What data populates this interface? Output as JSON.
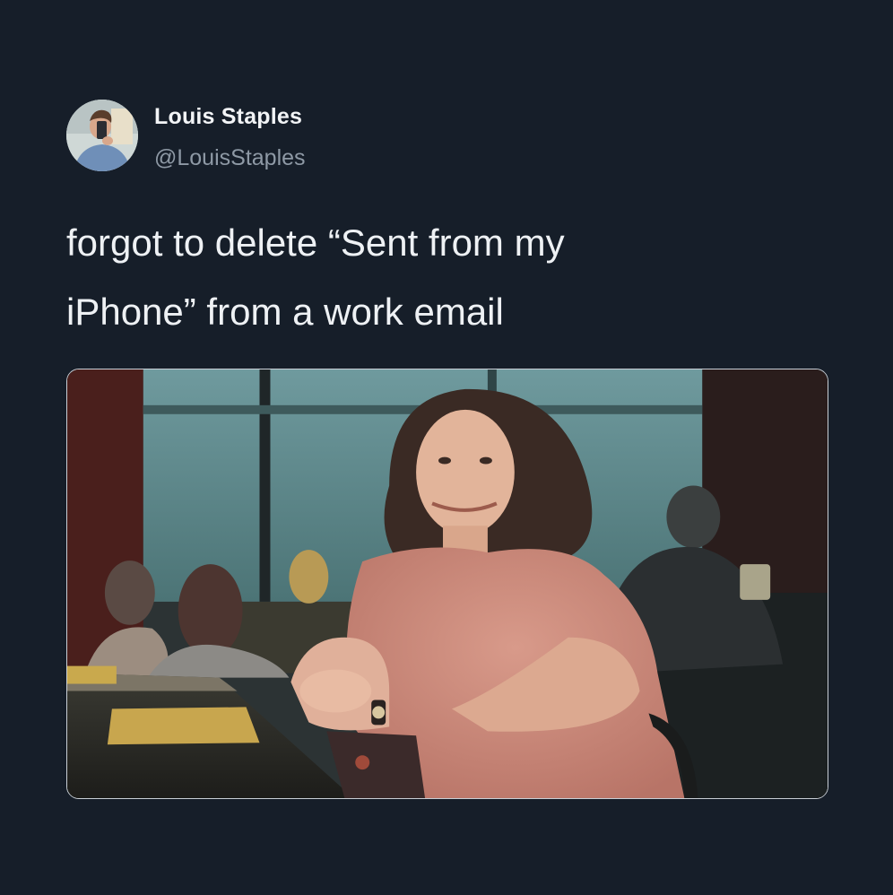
{
  "tweet": {
    "author": {
      "display_name": "Louis Staples",
      "handle": "@LouisStaples",
      "avatar_icon": "profile-photo"
    },
    "text_lines": [
      "forgot to delete “Sent from my",
      "iPhone” from a work email"
    ],
    "media": {
      "type": "photo"
    }
  },
  "colors": {
    "background": "#161e29",
    "text": "#eef1f4",
    "handle": "#8e99a5",
    "media_border": "#c9cfd6"
  }
}
